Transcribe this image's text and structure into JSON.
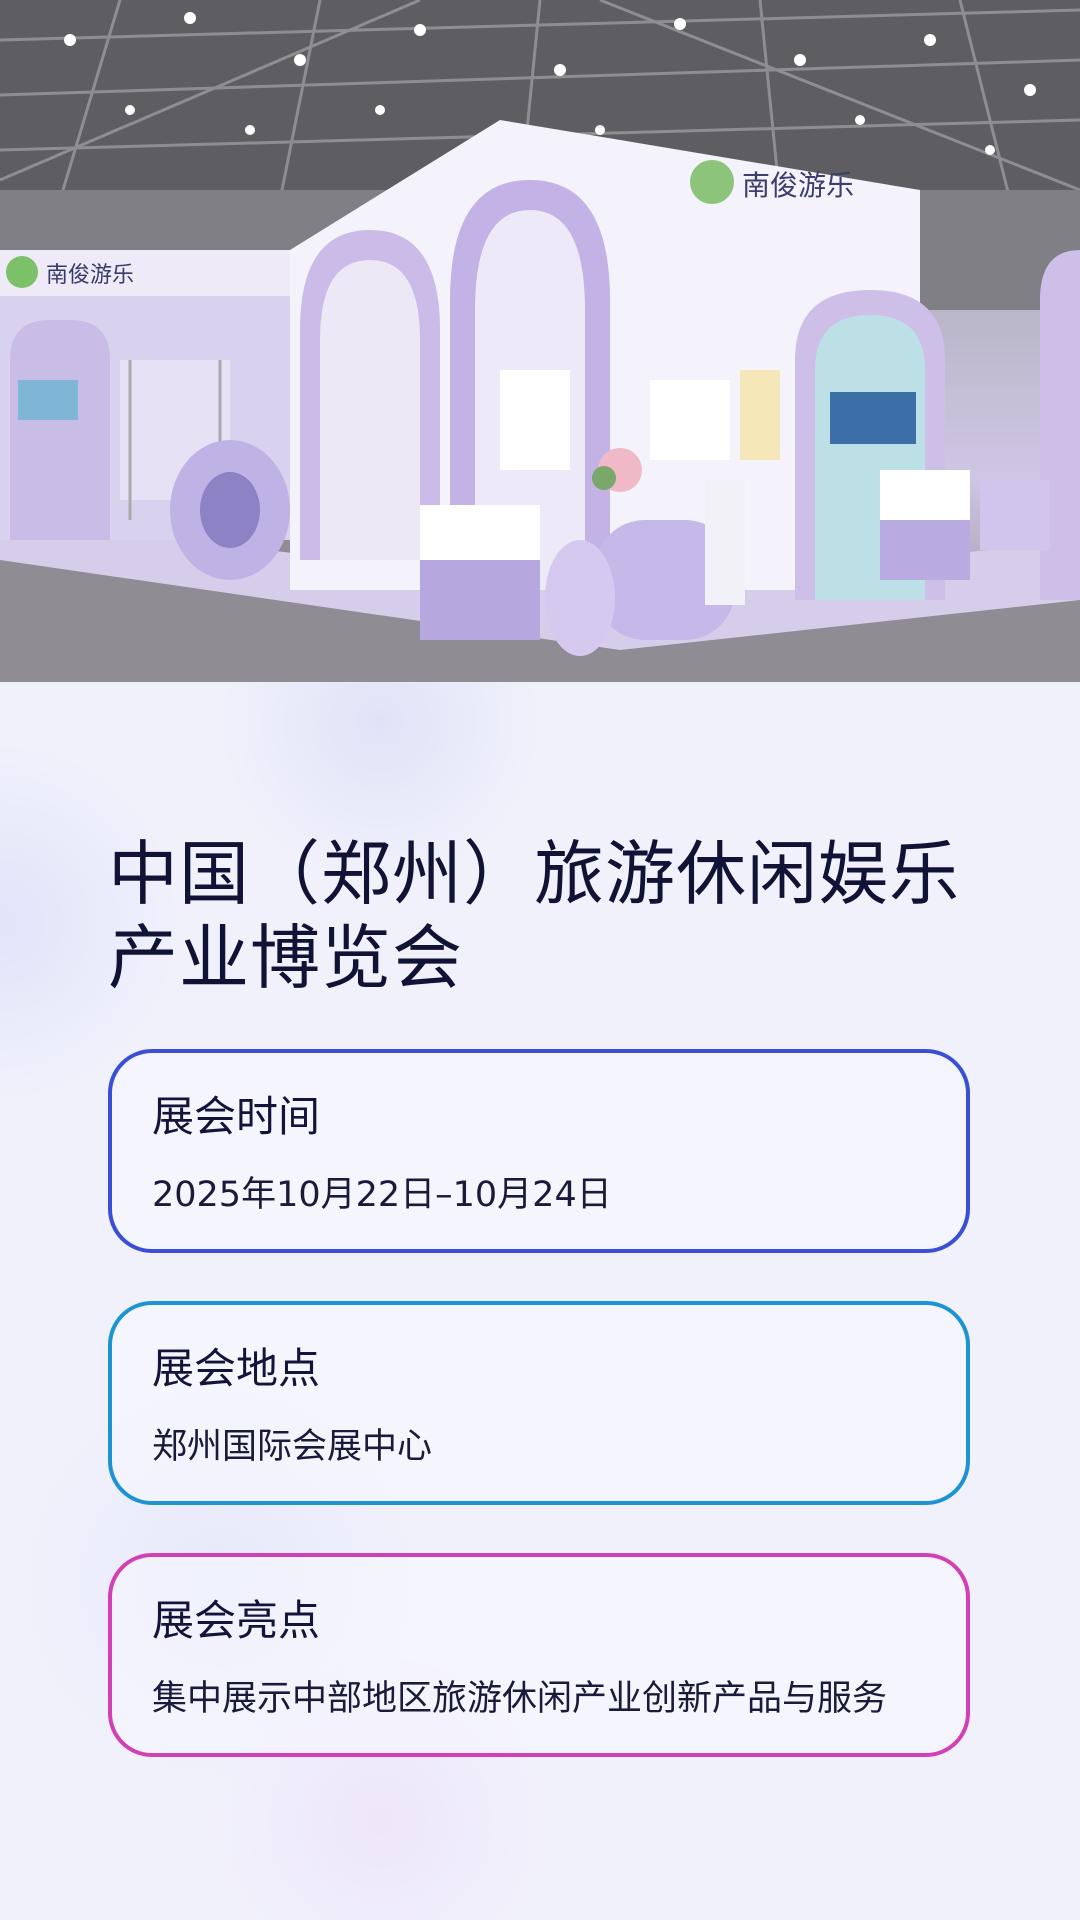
{
  "hero": {
    "image": "exhibition-booth-photo",
    "booth_text": "南俊游乐",
    "colors": {
      "booth": "#cdbfe8",
      "ceiling": "#5d5d62",
      "floor": "#8f8d93"
    }
  },
  "title": "中国（郑州）旅游休闲娱乐产业博览会",
  "cards": [
    {
      "label": "展会时间",
      "value": "2025年10月22日–10月24日",
      "color": "#3b4ed6"
    },
    {
      "label": "展会地点",
      "value": "郑州国际会展中心",
      "color": "#1d93d2"
    },
    {
      "label": "展会亮点",
      "value": "集中展示中部地区旅游休闲产业创新产品与服务",
      "color": "#d240b6"
    }
  ]
}
